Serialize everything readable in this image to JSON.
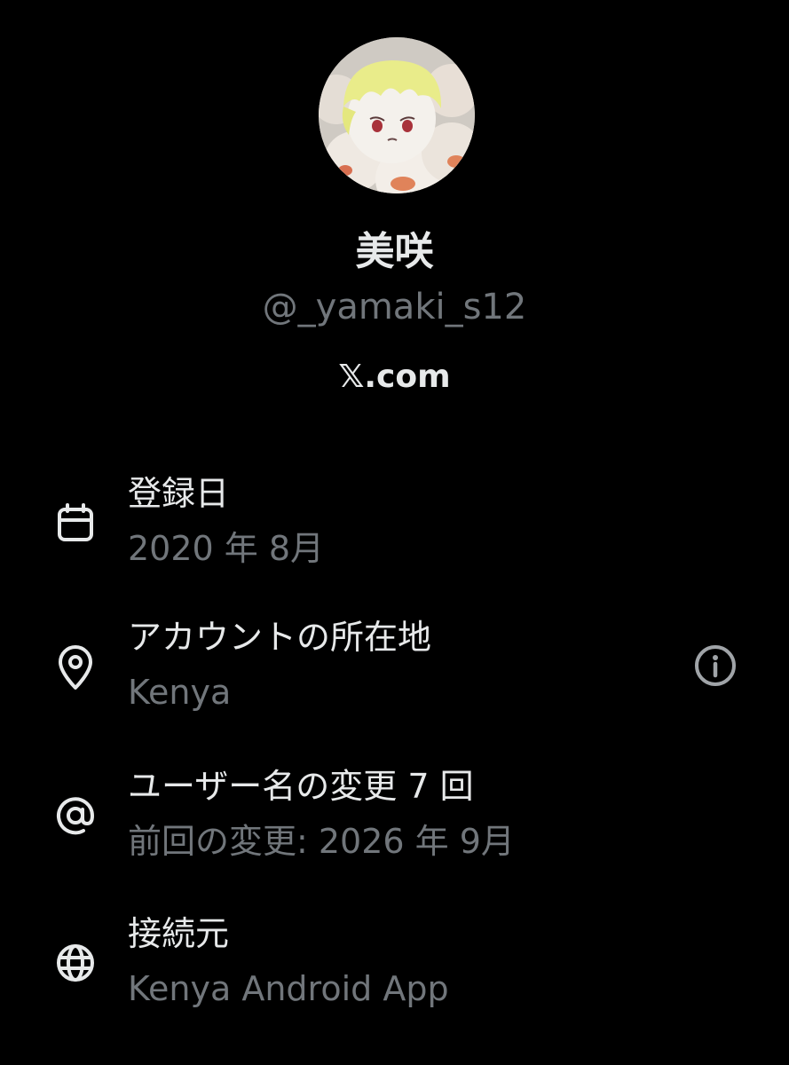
{
  "profile": {
    "display_name": "美咲",
    "handle": "@_yamaki_s12",
    "site": "𝕏.com"
  },
  "details": [
    {
      "icon": "calendar-icon",
      "label": "登録日",
      "value": "2020 年 8月"
    },
    {
      "icon": "location-pin-icon",
      "label": "アカウントの所在地",
      "value": "Kenya",
      "trailing_icon": "info-icon"
    },
    {
      "icon": "at-sign-icon",
      "label": "ユーザー名の変更 7 回",
      "value": "前回の変更: 2026 年 9月"
    },
    {
      "icon": "globe-icon",
      "label": "接続元",
      "value": "Kenya Android App"
    }
  ],
  "colors": {
    "background": "#000000",
    "primary_text": "#e7e9ea",
    "secondary_text": "#71767b"
  }
}
